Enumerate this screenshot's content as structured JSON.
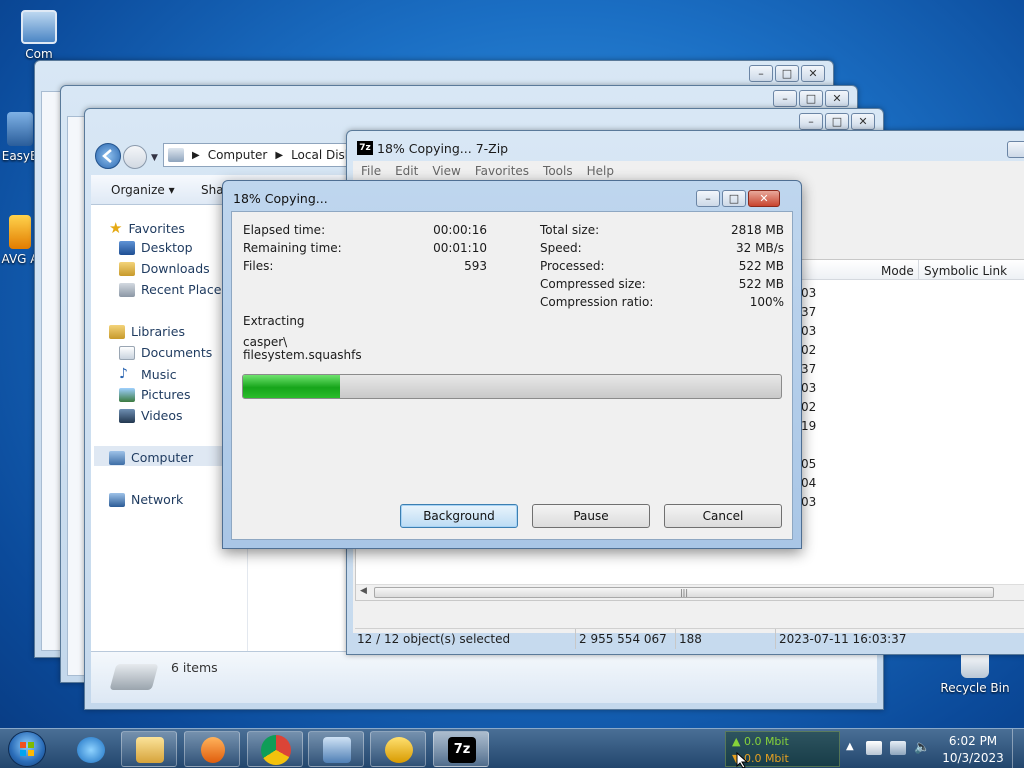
{
  "desktop": {
    "icons": [
      {
        "label": "Com"
      },
      {
        "label": "EasyB"
      },
      {
        "label": "AVG A"
      },
      {
        "label": "Recycle Bin"
      }
    ]
  },
  "explorer": {
    "breadcrumb": [
      "Computer",
      "Local Disk (C"
    ],
    "toolbar": {
      "organize": "Organize ▾",
      "share": "Shar"
    },
    "nav": {
      "favorites": "Favorites",
      "desktop": "Desktop",
      "downloads": "Downloads",
      "recent": "Recent Places",
      "libraries": "Libraries",
      "documents": "Documents",
      "music": "Music",
      "pictures": "Pictures",
      "videos": "Videos",
      "computer": "Computer",
      "network": "Network"
    },
    "status": "6 items"
  },
  "sevenzip": {
    "title": "18% Copying... 7-Zip",
    "menu": [
      "File",
      "Edit",
      "View",
      "Favorites",
      "Tools",
      "Help"
    ],
    "columns": {
      "mode": "Mode",
      "symlink": "Symbolic Link"
    },
    "row_fragments": [
      "03",
      "37",
      "03",
      "02",
      "37",
      "03",
      "02",
      "19",
      "05",
      "04",
      "03"
    ],
    "statusbar": {
      "selected": "12 / 12 object(s) selected",
      "size": "2 955 554 067",
      "count": "188",
      "date": "2023-07-11 16:03:37"
    }
  },
  "dialog": {
    "title": "18% Copying...",
    "left": {
      "elapsed_label": "Elapsed time:",
      "elapsed_value": "00:00:16",
      "remaining_label": "Remaining time:",
      "remaining_value": "00:01:10",
      "files_label": "Files:",
      "files_value": "593"
    },
    "right": {
      "total_label": "Total size:",
      "total_value": "2818 MB",
      "speed_label": "Speed:",
      "speed_value": "32 MB/s",
      "processed_label": "Processed:",
      "processed_value": "522 MB",
      "compressed_label": "Compressed size:",
      "compressed_value": "522 MB",
      "ratio_label": "Compression ratio:",
      "ratio_value": "100%"
    },
    "operation": "Extracting",
    "path1": "casper\\",
    "path2": "filesystem.squashfs",
    "progress": 0.18,
    "buttons": {
      "background": "Background",
      "pause": "Pause",
      "cancel": "Cancel"
    }
  },
  "taskbar": {
    "net_up": "▲ 0.0 Mbit",
    "net_down": "▼ 0.0 Mbit",
    "time": "6:02 PM",
    "date": "10/3/2023"
  },
  "colors": {
    "progress_fill": "#1aad1a",
    "accent": "#1b6fc4"
  }
}
